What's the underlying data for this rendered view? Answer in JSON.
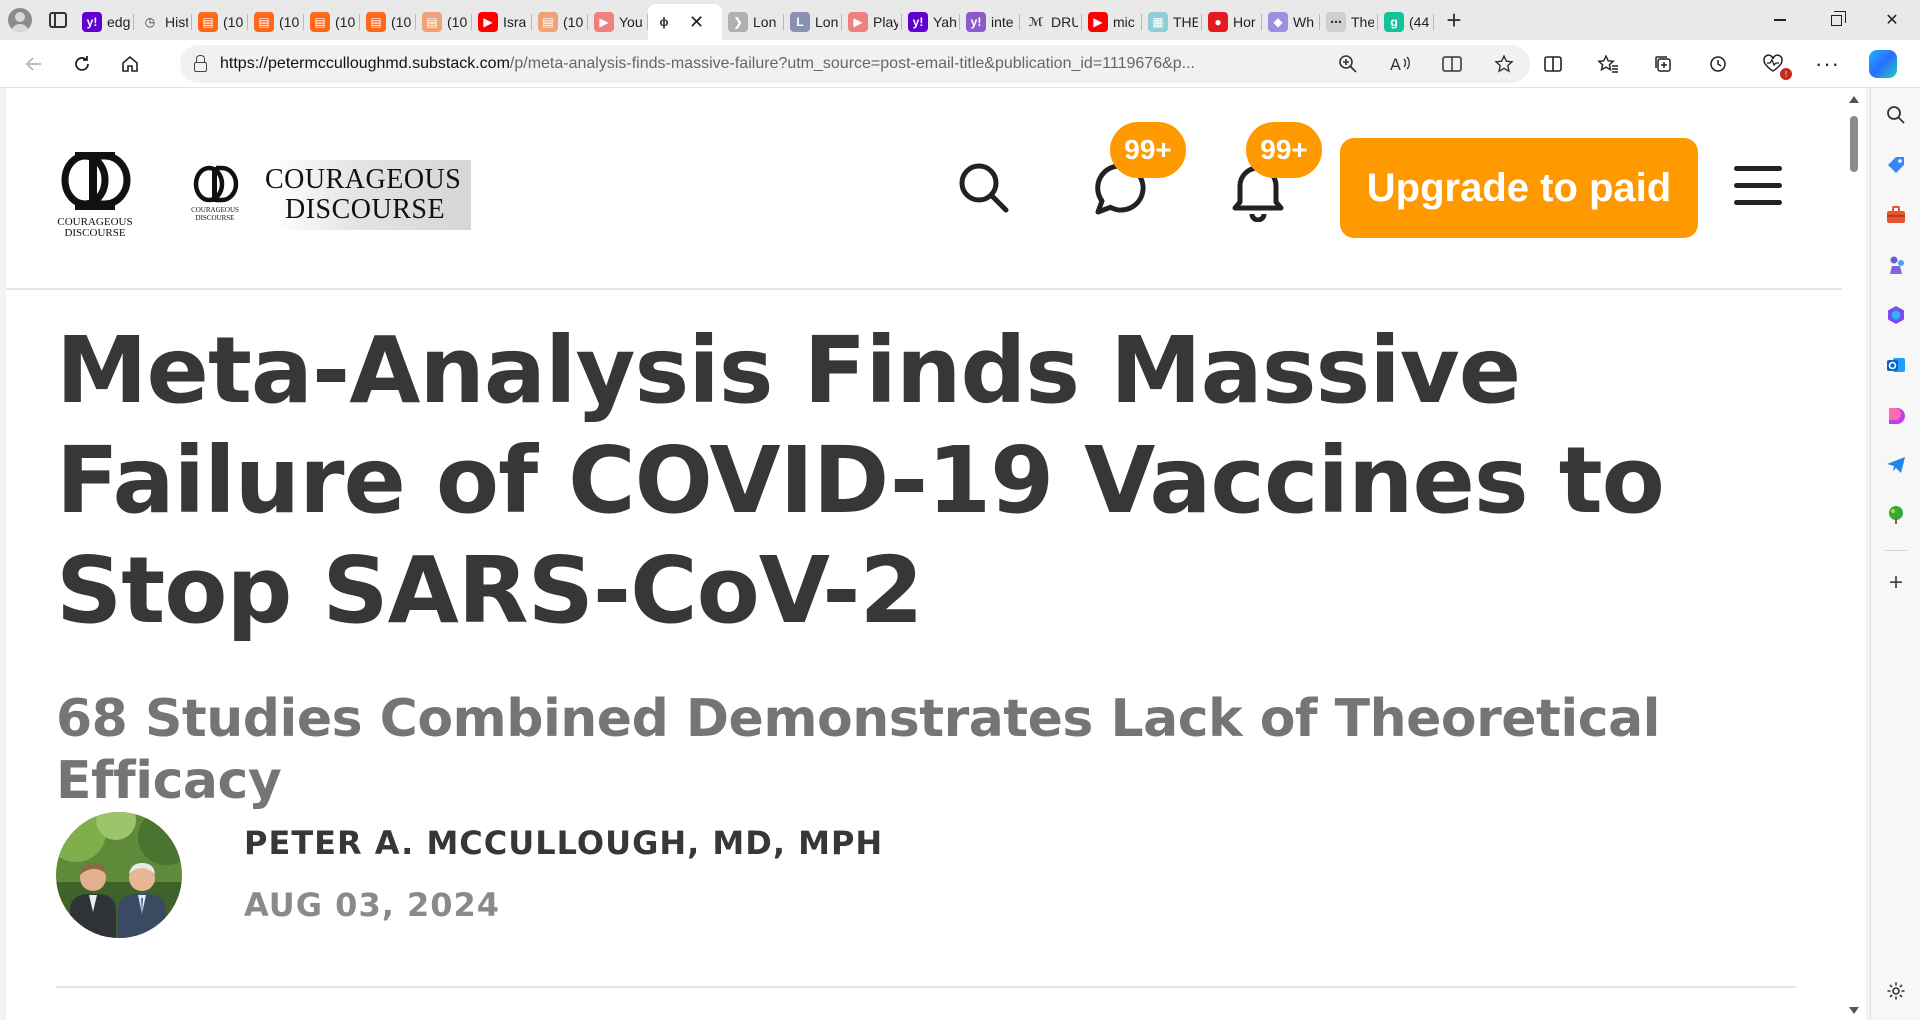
{
  "browser": {
    "tabs": [
      {
        "label": "edg",
        "icon": "yahoo-icon",
        "color": "#6001d2",
        "glyph": "y!"
      },
      {
        "label": "Hist",
        "icon": "history-icon",
        "color": "#e9e9e9",
        "glyph": "◷"
      },
      {
        "label": "(10",
        "icon": "substack-icon",
        "color": "#ff6719",
        "glyph": "▤"
      },
      {
        "label": "(10",
        "icon": "substack-icon",
        "color": "#ff6719",
        "glyph": "▤"
      },
      {
        "label": "(10",
        "icon": "substack-icon",
        "color": "#ff6719",
        "glyph": "▤"
      },
      {
        "label": "(10",
        "icon": "substack-icon",
        "color": "#ff6719",
        "glyph": "▤"
      },
      {
        "label": "(10",
        "icon": "substack-icon",
        "color": "#f0a37a",
        "glyph": "▤"
      },
      {
        "label": "Isra",
        "icon": "youtube-icon",
        "color": "#ff0000",
        "glyph": "▶"
      },
      {
        "label": "(10",
        "icon": "substack-icon",
        "color": "#f0a37a",
        "glyph": "▤"
      },
      {
        "label": "You",
        "icon": "youtube-icon",
        "color": "#f08080",
        "glyph": "▶"
      },
      {
        "label": "",
        "icon": "courageous-discourse-icon",
        "color": "#ffffff",
        "glyph": "ϕ",
        "active": true,
        "close": "✕"
      },
      {
        "label": "Lon",
        "icon": "arrow-icon",
        "color": "#b0b0b0",
        "glyph": "❯"
      },
      {
        "label": "Lon",
        "icon": "letter-l-icon",
        "color": "#8892b0",
        "glyph": "L"
      },
      {
        "label": "Play",
        "icon": "youtube-icon",
        "color": "#f08080",
        "glyph": "▶"
      },
      {
        "label": "Yah",
        "icon": "yahoo-icon",
        "color": "#6001d2",
        "glyph": "y!"
      },
      {
        "label": "inte",
        "icon": "yahoo-icon",
        "color": "#8a5cc9",
        "glyph": "y!"
      },
      {
        "label": "DRU",
        "icon": "drudge-icon",
        "color": "#e9e9e9",
        "glyph": "ℳ"
      },
      {
        "label": "mic",
        "icon": "youtube-icon",
        "color": "#ff0000",
        "glyph": "▶"
      },
      {
        "label": "THE",
        "icon": "image-icon",
        "color": "#8fd0d8",
        "glyph": "▦"
      },
      {
        "label": "Hor",
        "icon": "pin-icon",
        "color": "#e41b23",
        "glyph": "●"
      },
      {
        "label": "Wh",
        "icon": "shield-icon",
        "color": "#9a8fe0",
        "glyph": "◆"
      },
      {
        "label": "The",
        "icon": "dots-icon",
        "color": "#cfcfcf",
        "glyph": "⋯"
      },
      {
        "label": "(44",
        "icon": "grammarly-icon",
        "color": "#15c39a",
        "glyph": "g"
      }
    ],
    "new_tab": "+",
    "url_host": "https://petermcculloughmd.substack.com",
    "url_path": "/p/meta-analysis-finds-massive-failure?utm_source=post-email-title&publication_id=1119676&p..."
  },
  "header": {
    "logo_line1": "COURAGEOUS",
    "logo_line2": "DISCOURSE",
    "chat_badge": "99+",
    "notif_badge": "99+",
    "upgrade_label": "Upgrade to paid"
  },
  "post": {
    "title": "Meta-Analysis Finds Massive Failure of COVID-19 Vaccines to Stop SARS-CoV-2",
    "subtitle": "68 Studies Combined Demonstrates Lack of Theoretical Efficacy",
    "author": "PETER A. MCCULLOUGH, MD, MPH",
    "date": "AUG 03, 2024"
  },
  "colors": {
    "accent": "#ff9900",
    "title": "#363737",
    "subtitle": "#757575"
  }
}
